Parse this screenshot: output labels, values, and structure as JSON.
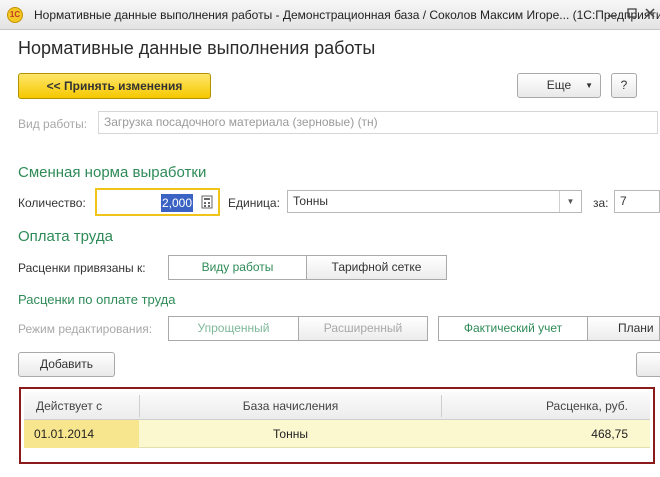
{
  "window": {
    "title": "Нормативные данные выполнения работы - Демонстрационная база / Соколов Максим Игоре...  (1С:Предприятие)",
    "app_icon_label": "1С"
  },
  "page": {
    "heading": "Нормативные данные выполнения работы"
  },
  "toolbar": {
    "accept_label": "<< Принять изменения",
    "more_label": "Еще",
    "help_label": "?"
  },
  "work_type": {
    "label": "Вид работы:",
    "value": "Загрузка посадочного материала (зерновые) (тн)"
  },
  "shift_norm": {
    "section_title": "Сменная норма выработки",
    "quantity_label": "Количество:",
    "quantity_value": "2,000",
    "unit_label": "Единица:",
    "unit_value": "Тонны",
    "per_label": "за:",
    "per_value": "7"
  },
  "payment": {
    "section_title": "Оплата труда",
    "bound_label": "Расценки привязаны к:",
    "bound_options": [
      "Виду работы",
      "Тарифной сетке"
    ],
    "bound_selected": "Виду работы"
  },
  "rates": {
    "section_title": "Расценки по оплате труда",
    "mode_label": "Режим редактирования:",
    "mode_options": [
      "Упрощенный",
      "Расширенный"
    ],
    "mode_selected": "Упрощенный",
    "accounting_options": [
      "Фактический учет",
      "Плани"
    ],
    "accounting_selected": "Фактический учет",
    "add_label": "Добавить",
    "table": {
      "columns": [
        "Действует с",
        "База начисления",
        "Расценка, руб."
      ],
      "rows": [
        [
          "01.01.2014",
          "Тонны",
          "468,75"
        ]
      ]
    }
  },
  "colors": {
    "accent_green": "#2e8b57",
    "button_yellow": "#f5c800",
    "selection_red": "#8b1a1a",
    "row_highlight": "#fbf7cf"
  }
}
